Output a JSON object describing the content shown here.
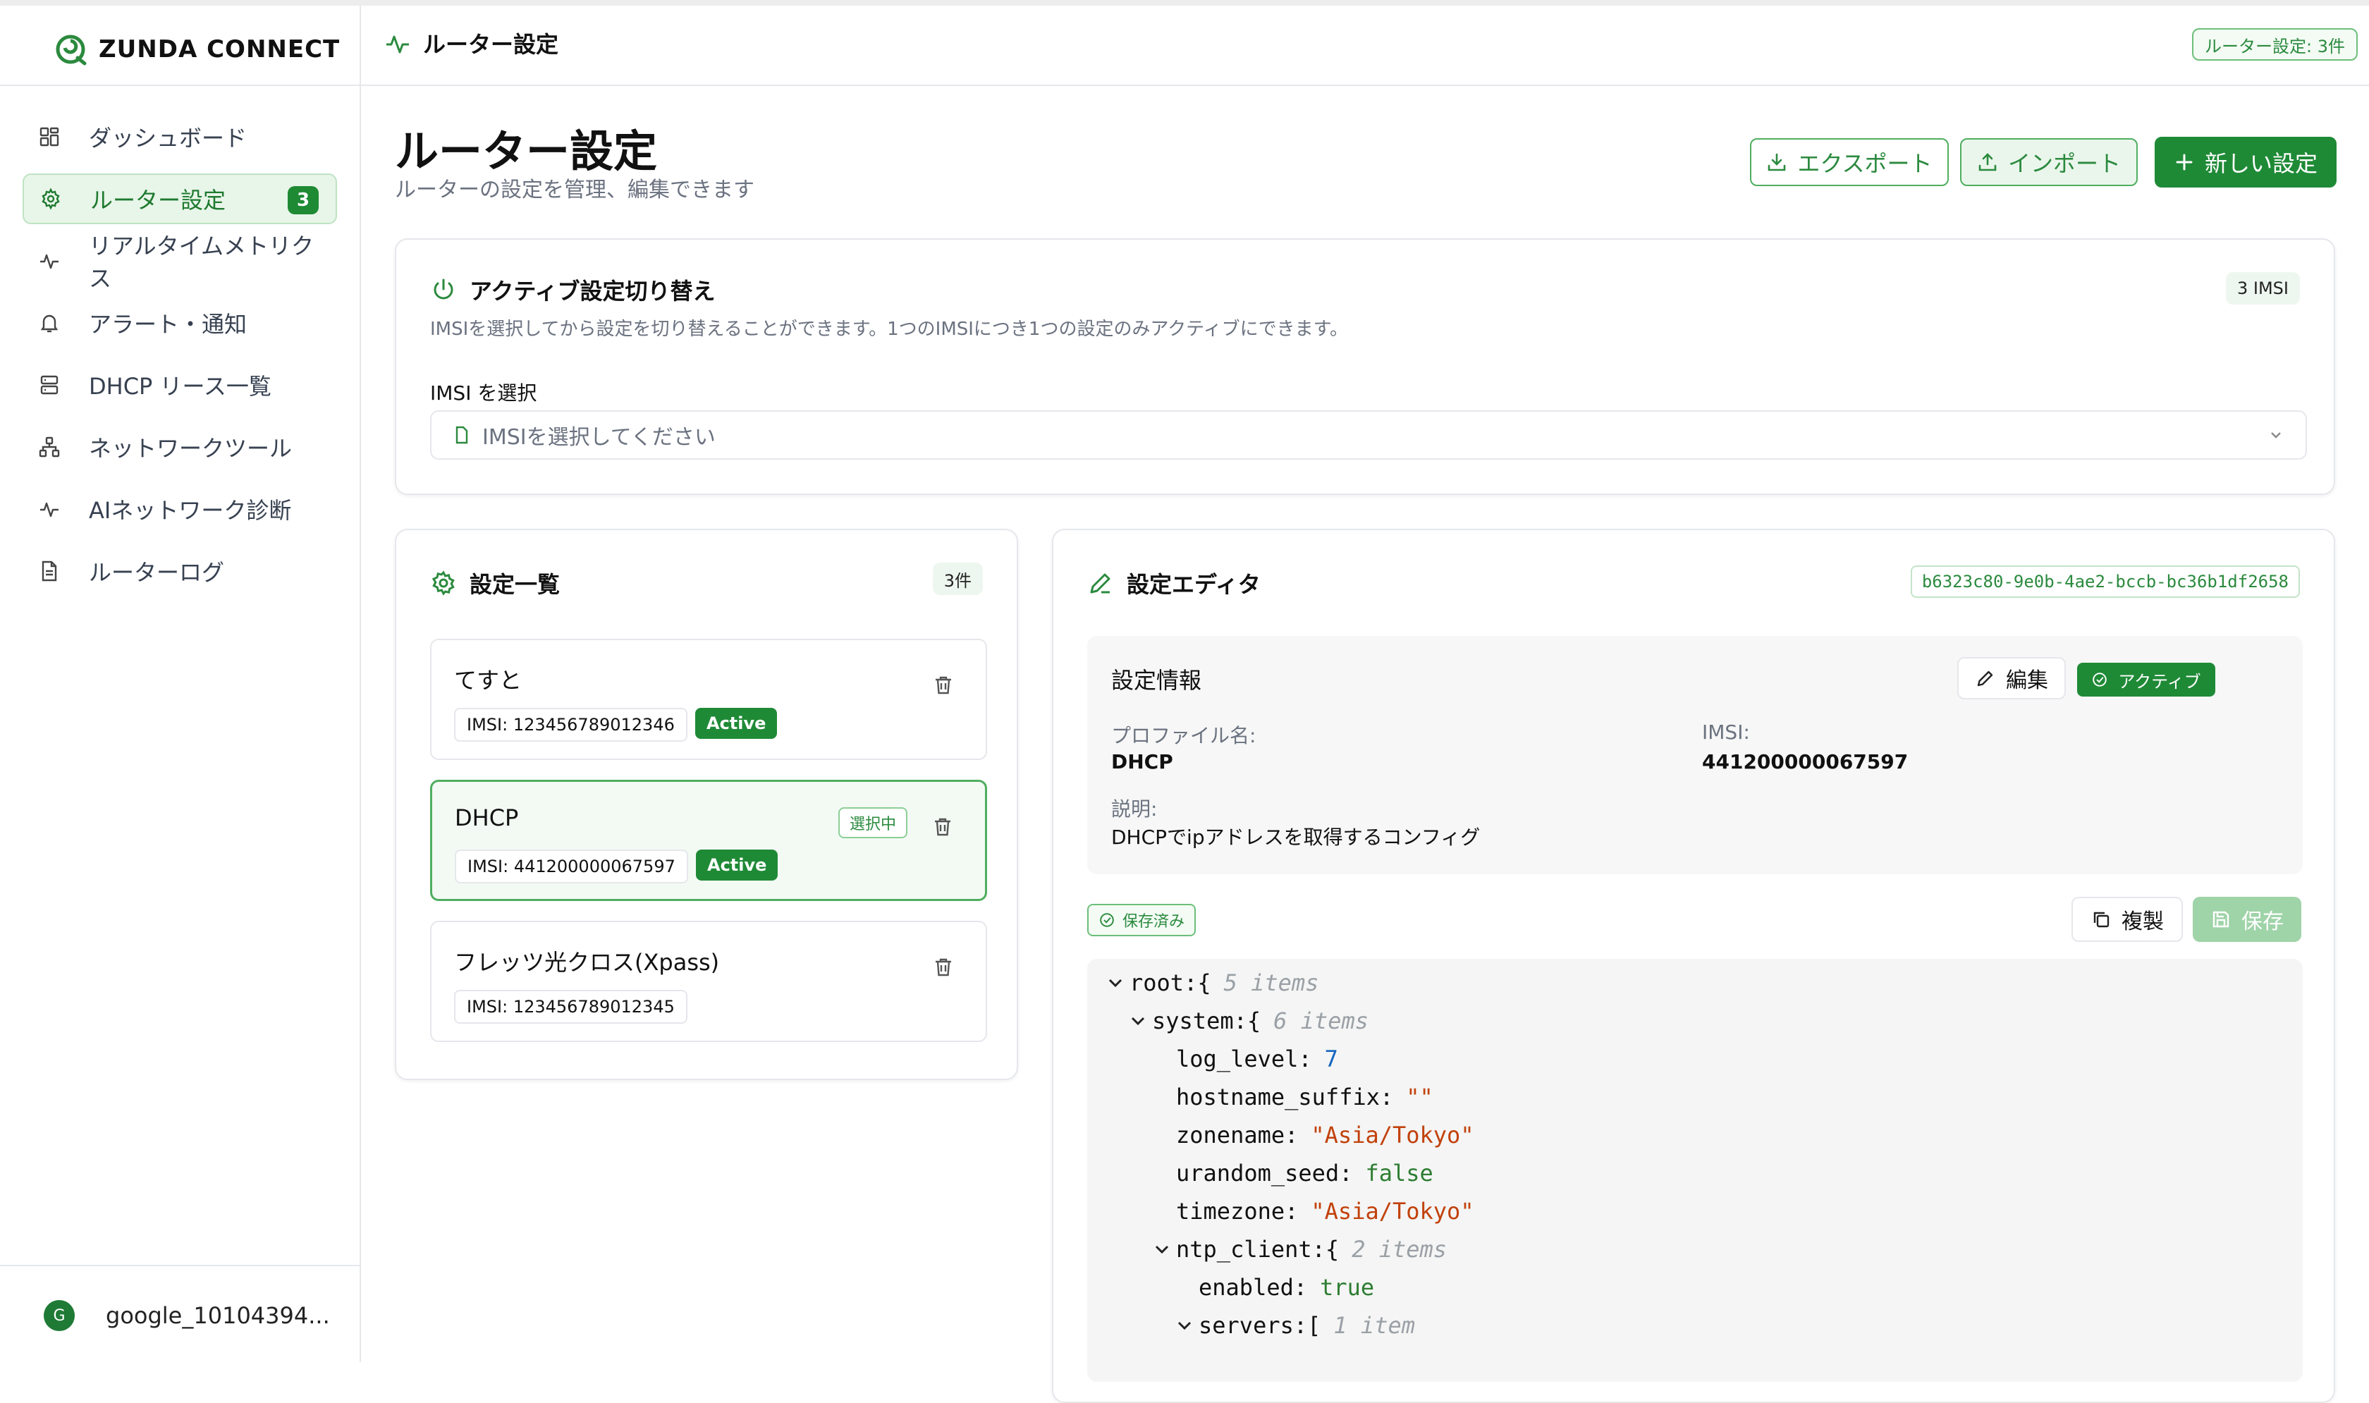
{
  "brand": {
    "name": "ZUNDA CONNECT"
  },
  "sidebar": {
    "items": [
      {
        "label": "ダッシュボード",
        "icon": "dashboard-icon"
      },
      {
        "label": "ルーター設定",
        "icon": "gear-icon",
        "badge": "3",
        "active": true
      },
      {
        "label": "リアルタイムメトリクス",
        "icon": "activity-icon"
      },
      {
        "label": "アラート・通知",
        "icon": "bell-icon"
      },
      {
        "label": "DHCP リース一覧",
        "icon": "server-icon"
      },
      {
        "label": "ネットワークツール",
        "icon": "network-icon"
      },
      {
        "label": "AIネットワーク診断",
        "icon": "activity-icon"
      },
      {
        "label": "ルーターログ",
        "icon": "file-icon"
      }
    ],
    "user": {
      "initial": "G",
      "name": "google_10104394..."
    }
  },
  "header": {
    "title": "ルーター設定",
    "badge": "ルーター設定: 3件"
  },
  "page": {
    "title": "ルーター設定",
    "subtitle": "ルーターの設定を管理、編集できます",
    "export_label": "エクスポート",
    "import_label": "インポート",
    "new_label": "新しい設定"
  },
  "active_switch": {
    "title": "アクティブ設定切り替え",
    "description": "IMSIを選択してから設定を切り替えることができます。1つのIMSIにつき1つの設定のみアクティブにできます。",
    "count_badge": "3 IMSI",
    "select_label": "IMSI を選択",
    "select_placeholder": "IMSIを選択してください"
  },
  "config_list": {
    "title": "設定一覧",
    "count": "3件",
    "items": [
      {
        "name": "てすと",
        "imsi": "IMSI: 123456789012346",
        "status": "Active"
      },
      {
        "name": "DHCP",
        "imsi": "IMSI: 441200000067597",
        "status": "Active",
        "selected_label": "選択中"
      },
      {
        "name": "フレッツ光クロス(Xpass)",
        "imsi": "IMSI: 123456789012345"
      }
    ]
  },
  "editor": {
    "title": "設定エディタ",
    "id": "b6323c80-9e0b-4ae2-bccb-bc36b1df2658",
    "info_title": "設定情報",
    "edit_label": "編集",
    "active_label": "アクティブ",
    "profile_label": "プロファイル名:",
    "profile_value": "DHCP",
    "imsi_label": "IMSI:",
    "imsi_value": "441200000067597",
    "desc_label": "説明:",
    "desc_value": "DHCPでipアドレスを取得するコンフィグ",
    "saved_label": "保存済み",
    "duplicate_label": "複製",
    "save_label": "保存",
    "json": {
      "root_key": "root:",
      "root_count": "5 items",
      "system_key": "system:",
      "system_count": "6 items",
      "log_level_key": "log_level:",
      "log_level_val": "7",
      "hostname_key": "hostname_suffix:",
      "hostname_val": "\"\"",
      "zonename_key": "zonename:",
      "zonename_val": "\"Asia/Tokyo\"",
      "urandom_key": "urandom_seed:",
      "urandom_val": "false",
      "timezone_key": "timezone:",
      "timezone_val": "\"Asia/Tokyo\"",
      "ntp_key": "ntp_client:",
      "ntp_count": "2 items",
      "enabled_key": "enabled:",
      "enabled_val": "true",
      "servers_key": "servers:",
      "servers_count": "1 item"
    }
  },
  "colors": {
    "accent": "#1f8a36",
    "accent_light": "#e8f5e9"
  }
}
